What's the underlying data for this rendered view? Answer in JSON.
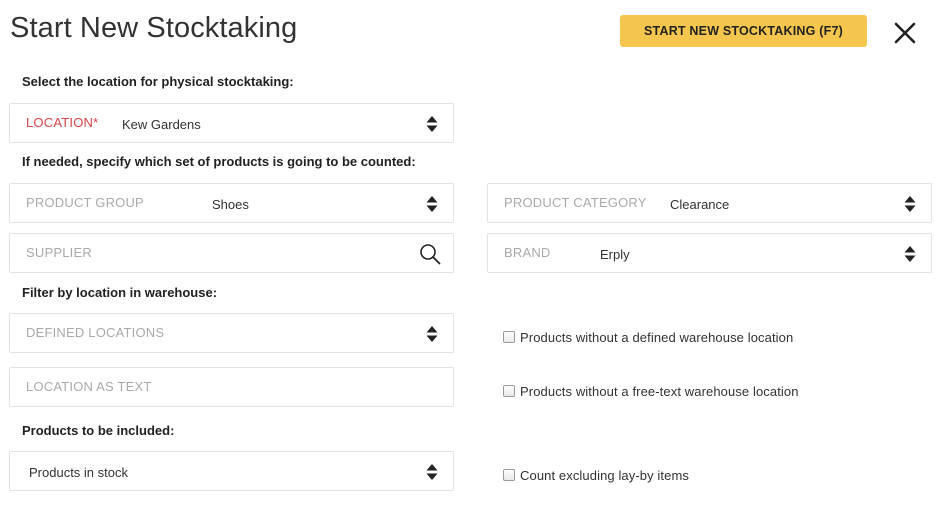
{
  "header": {
    "title": "Start New Stocktaking",
    "start_button_label": "START NEW STOCKTAKING (F7)"
  },
  "sections": {
    "location_prompt": "Select the location for physical stocktaking:",
    "products_prompt": "If needed, specify which set of products is going to be counted:",
    "warehouse_prompt": "Filter by location in warehouse:",
    "included_prompt": "Products to be included:"
  },
  "fields": {
    "location": {
      "label": "LOCATION*",
      "value": "Kew Gardens"
    },
    "product_group": {
      "label": "PRODUCT GROUP",
      "value": "Shoes"
    },
    "product_category": {
      "label": "PRODUCT CATEGORY",
      "value": "Clearance"
    },
    "supplier": {
      "label": "SUPPLIER",
      "value": ""
    },
    "brand": {
      "label": "BRAND",
      "value": "Erply"
    },
    "defined_locations": {
      "label": "DEFINED LOCATIONS",
      "value": ""
    },
    "location_as_text": {
      "label": "LOCATION AS TEXT",
      "value": ""
    },
    "products_included": {
      "value": "Products in stock"
    }
  },
  "checkboxes": {
    "no_defined_location": {
      "label": "Products without a defined warehouse location",
      "checked": false
    },
    "no_freetext_location": {
      "label": "Products without a free-text warehouse location",
      "checked": false
    },
    "exclude_layby": {
      "label": "Count excluding lay-by items",
      "checked": false
    }
  },
  "colors": {
    "accent_button": "#f5c64e",
    "required_label": "#d64545",
    "field_border": "#e3e3e3",
    "placeholder_label": "#aaaaaa"
  },
  "icons": {
    "close": "close-icon",
    "select_arrows": "sort-arrows-icon",
    "search": "search-icon"
  }
}
